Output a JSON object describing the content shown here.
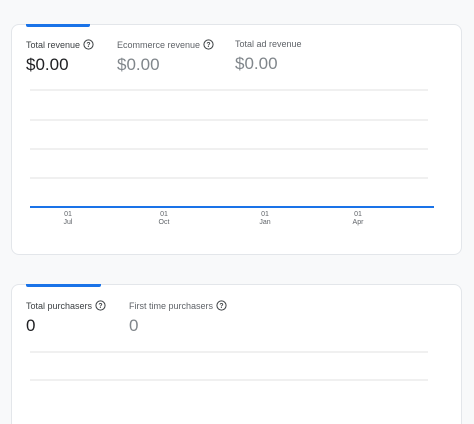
{
  "revenue_card": {
    "metrics": [
      {
        "label": "Total revenue",
        "value": "$0.00"
      },
      {
        "label": "Ecommerce revenue",
        "value": "$0.00"
      },
      {
        "label": "Total ad revenue",
        "value": "$0.00"
      }
    ],
    "x_ticks": [
      {
        "day": "01",
        "month": "Jul"
      },
      {
        "day": "01",
        "month": "Oct"
      },
      {
        "day": "01",
        "month": "Jan"
      },
      {
        "day": "01",
        "month": "Apr"
      }
    ],
    "series_value": 0
  },
  "purchasers_card": {
    "metrics": [
      {
        "label": "Total purchasers",
        "value": "0"
      },
      {
        "label": "First time purchasers",
        "value": "0"
      }
    ]
  },
  "colors": {
    "accent": "#1a73e8",
    "grid": "#e0e0e0"
  },
  "icons": {
    "help": "help-circle-icon"
  }
}
